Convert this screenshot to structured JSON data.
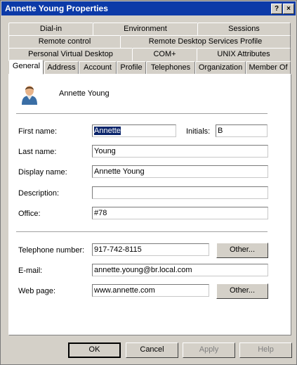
{
  "window": {
    "title": "Annette Young Properties",
    "help_label": "?",
    "close_label": "×"
  },
  "tabs": {
    "row1": [
      "Dial-in",
      "Environment",
      "Sessions"
    ],
    "row2": [
      "Remote control",
      "Remote Desktop Services Profile"
    ],
    "row3": [
      "Personal Virtual Desktop",
      "COM+",
      "UNIX Attributes"
    ],
    "row4": [
      "General",
      "Address",
      "Account",
      "Profile",
      "Telephones",
      "Organization",
      "Member Of"
    ],
    "active": "General"
  },
  "general": {
    "display_header": "Annette Young",
    "first_name_label": "First name:",
    "first_name": "Annette",
    "initials_label": "Initials:",
    "initials": "B",
    "last_name_label": "Last name:",
    "last_name": "Young",
    "display_name_label": "Display name:",
    "display_name": "Annette Young",
    "description_label": "Description:",
    "description": "",
    "office_label": "Office:",
    "office": "#78",
    "telephone_label": "Telephone number:",
    "telephone": "917-742-8115",
    "other_label": "Other...",
    "email_label": "E-mail:",
    "email": "annette.young@br.local.com",
    "webpage_label": "Web page:",
    "webpage": "www.annette.com"
  },
  "buttons": {
    "ok": "OK",
    "cancel": "Cancel",
    "apply": "Apply",
    "help": "Help"
  },
  "colors": {
    "titlebar": "#0c3aa8",
    "dialog_face": "#d4d0c8",
    "selection": "#0a246a"
  }
}
